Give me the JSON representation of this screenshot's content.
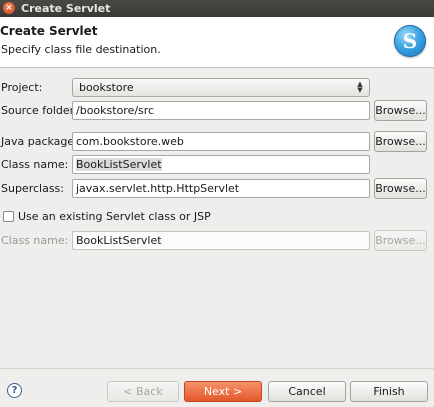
{
  "window": {
    "title": "Create Servlet"
  },
  "header": {
    "title": "Create Servlet",
    "subtitle": "Specify class file destination.",
    "logo_letter": "S"
  },
  "form": {
    "project_label": "Project:",
    "project_value": "bookstore",
    "source_folder_label": "Source folder:",
    "source_folder_value": "/bookstore/src",
    "java_package_label": "Java package:",
    "java_package_value": "com.bookstore.web",
    "class_name_label": "Class name:",
    "class_name_value": "BookListServlet",
    "superclass_label": "Superclass:",
    "superclass_value": "javax.servlet.http.HttpServlet",
    "browse_label": "Browse...",
    "existing_checkbox_label": "Use an existing Servlet class or JSP",
    "existing_checked": false,
    "existing_class_label": "Class name:",
    "existing_class_value": "BookListServlet"
  },
  "footer": {
    "help_symbol": "?",
    "back_label": "< Back",
    "next_label": "Next >",
    "cancel_label": "Cancel",
    "finish_label": "Finish"
  },
  "colors": {
    "primary_button": "#e4572a",
    "title_bar": "#3a3936"
  }
}
